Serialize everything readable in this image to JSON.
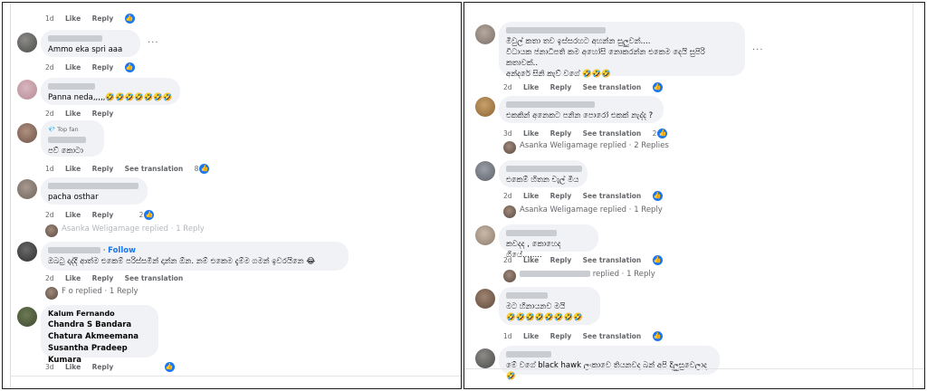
{
  "left": {
    "top_meta": {
      "time": "1d",
      "like": "Like",
      "reply": "Reply"
    },
    "comments": [
      {
        "text": "Ammo eka spri aaa",
        "time": "2d",
        "like": "Like",
        "reply": "Reply",
        "more": "..."
      },
      {
        "text": "Panna neda,,,,,",
        "emoji": "🤣🤣🤣🤣🤣🤣🤣",
        "time": "2d",
        "like": "Like",
        "reply": "Reply"
      },
      {
        "badge": "Top fan",
        "text": "පව් කොටා",
        "time": "1d",
        "like": "Like",
        "reply": "Reply",
        "see_translation": "See translation",
        "reaction_count": "8"
      },
      {
        "text": "pacha osthar",
        "time": "2d",
        "like": "Like",
        "reply": "Reply",
        "reaction_count": "2",
        "replied": "Asanka Weligamage replied · 1 Reply"
      },
      {
        "follow": "Follow",
        "text": "ඔබටු දාද්දි ආත්ම එකෙම් පරිස්සමින් දාන්න ඕන. නම් එකෙම දැම්ම ගමන් ඉවරයිනෙ",
        "emoji": "😂",
        "time": "2d",
        "like": "Like",
        "reply": "Reply",
        "see_translation": "See translation",
        "replied": "F        o replied · 1 Reply"
      },
      {
        "tagged": [
          "Kalum Fernando",
          "Chandra S Bandara",
          "Chatura Akmeemana",
          "Susantha Pradeep Kumara"
        ],
        "time": "3d",
        "like": "Like",
        "reply": "Reply"
      }
    ]
  },
  "right": {
    "comments": [
      {
        "line1": "මිවුල් කතා තව ඉස්සරහට අහන්න සුලුවන්....",
        "line2": "විධායක ජනාධිපති කම අහෝසි නොකරන්න එකෙම දෙයි සුපිරි කතාවක්..",
        "line3": "අන්දරේ සිනි කැව් වගේ",
        "emoji": "🤣🤣🤣",
        "more": "...",
        "time": "2d",
        "like": "Like",
        "reply": "Reply",
        "see_translation": "See translation"
      },
      {
        "text": "එකකින් අනෙකට පනින පොරෝ එකක් නැද්ද ?",
        "time": "3d",
        "like": "Like",
        "reply": "Reply",
        "see_translation": "See translation",
        "reaction_count": "2",
        "replied": "Asanka Weligamage replied · 2 Replies"
      },
      {
        "text": "එකෙම් හිතන චැල් මිය",
        "time": "2d",
        "like": "Like",
        "reply": "Reply",
        "see_translation": "See translation",
        "replied": "Asanka Weligamage replied · 1 Reply"
      },
      {
        "text": "කවදද , කොහෙද ගියේ........",
        "time": "2d",
        "like": "Like",
        "reply": "Reply",
        "see_translation": "See translation",
        "replied": "replied · 1 Reply"
      },
      {
        "text": "මට හිනායනව මයි",
        "emoji": "🤣🤣🤣🤣🤣🤣🤣🤣",
        "time": "1d",
        "like": "Like",
        "reply": "Reply",
        "see_translation": "See translation"
      },
      {
        "text": "මේ වගේ black hawk ලංකාවෙ තියනවද බන් අපි දිලුසුවෙලාද",
        "emoji": "🤣"
      }
    ]
  },
  "colors": {
    "link": "#1877f2",
    "bubble": "#f0f2f5",
    "meta": "#65676b"
  }
}
